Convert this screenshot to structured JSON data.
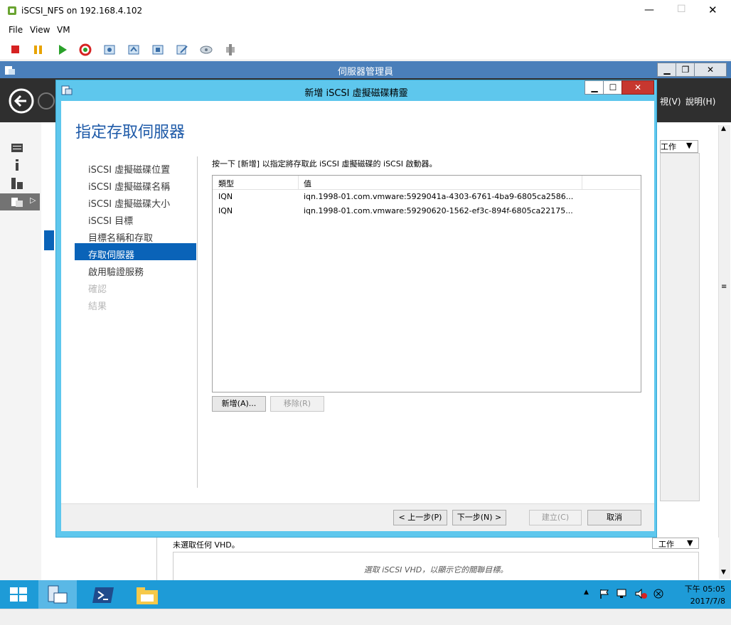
{
  "vsphere": {
    "title": "iSCSI_NFS on 192.168.4.102",
    "menu": [
      "File",
      "View",
      "VM"
    ]
  },
  "server_manager": {
    "title": "伺服器管理員",
    "menu_visible": [
      "視(V)",
      "說明(H)"
    ],
    "tasks_label": "工作",
    "tasks_label_bottom": "工作",
    "bottom_status": "未選取任何 VHD。",
    "bottom_hint": "選取 iSCSI VHD，以顯示它的關聯目標。"
  },
  "wizard": {
    "title": "新增 iSCSI 虛擬磁碟精靈",
    "heading": "指定存取伺服器",
    "steps": [
      {
        "label": "iSCSI 虛擬磁碟位置",
        "state": "done"
      },
      {
        "label": "iSCSI 虛擬磁碟名稱",
        "state": "done"
      },
      {
        "label": "iSCSI 虛擬磁碟大小",
        "state": "done"
      },
      {
        "label": "iSCSI 目標",
        "state": "done"
      },
      {
        "label": "目標名稱和存取",
        "state": "done"
      },
      {
        "label": "存取伺服器",
        "state": "active"
      },
      {
        "label": "啟用驗證服務",
        "state": "done"
      },
      {
        "label": "確認",
        "state": "disabled"
      },
      {
        "label": "結果",
        "state": "disabled"
      }
    ],
    "instruction": "按一下 [新增] 以指定將存取此 iSCSI 虛擬磁碟的 iSCSI 啟動器。",
    "table": {
      "headers": [
        "類型",
        "值"
      ],
      "rows": [
        {
          "type": "IQN",
          "value": "iqn.1998-01.com.vmware:5929041a-4303-6761-4ba9-6805ca2586..."
        },
        {
          "type": "IQN",
          "value": "iqn.1998-01.com.vmware:59290620-1562-ef3c-894f-6805ca22175..."
        }
      ]
    },
    "add_label": "新增(A)...",
    "remove_label": "移除(R)",
    "back_label": "< 上一步(P)",
    "next_label": "下一步(N) >",
    "create_label": "建立(C)",
    "cancel_label": "取消"
  },
  "taskbar": {
    "time": "下午 05:05",
    "date": "2017/7/8"
  },
  "colors": {
    "wizard_frame": "#5ec7ed",
    "heading": "#1e5aa8",
    "selection": "#0a63b8",
    "taskbar": "#1e9bd7"
  }
}
